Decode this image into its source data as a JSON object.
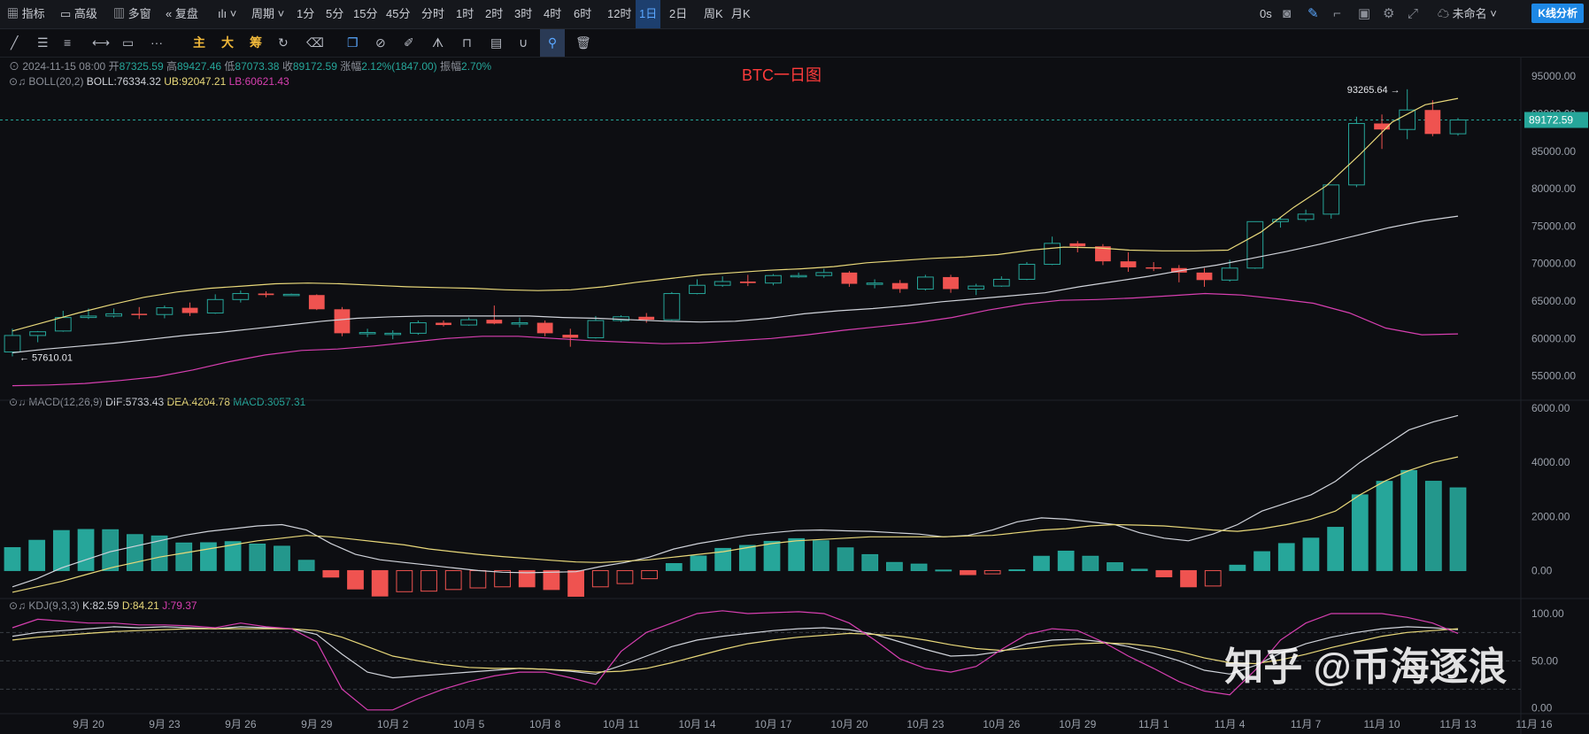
{
  "topbar": {
    "indicators": "指标",
    "advanced": "高级",
    "multi_window": "多窗",
    "replay": "复盘",
    "period": "周期",
    "intervals": [
      "1分",
      "5分",
      "15分",
      "45分",
      "分时",
      "1时",
      "2时",
      "3时",
      "4时",
      "6时",
      "12时",
      "1日",
      "2日",
      "周K",
      "月K"
    ],
    "active_interval": "1日",
    "latency": "0s",
    "layout_name": "未命名",
    "kline_button": "K线分析"
  },
  "toolbar2": {
    "labels": [
      "主",
      "大",
      "筹"
    ]
  },
  "info_rows": {
    "ohlc": {
      "date": "2024-11-15 08:00",
      "open_label": "开",
      "open": "87325.59",
      "high_label": "高",
      "high": "89427.46",
      "low_label": "低",
      "low": "87073.38",
      "close_label": "收",
      "close": "89172.59",
      "change_label": "涨幅",
      "change": "2.12%(1847.00)",
      "amp_label": "振幅",
      "amp": "2.70%"
    },
    "boll": {
      "name": "BOLL(20,2)",
      "boll": "BOLL:76334.32",
      "ub": "UB:92047.21",
      "lb": "LB:60621.43"
    },
    "macd": {
      "name": "MACD(12,26,9)",
      "dif": "DIF:5733.43",
      "dea": "DEA:4204.78",
      "macd": "MACD:3057.31"
    },
    "kdj": {
      "name": "KDJ(9,3,3)",
      "k": "K:82.59",
      "d": "D:84.21",
      "j": "J:79.37"
    }
  },
  "colors": {
    "up": "#26a69a",
    "down": "#ef5350",
    "boll_mid": "#d0d3da",
    "boll_ub": "#e8d87a",
    "boll_lb": "#d63fb0",
    "dif": "#d0d3da",
    "dea": "#e8d87a",
    "k": "#d0d3da",
    "d": "#e8d87a",
    "j": "#d63fb0",
    "title": "#ff3b3b"
  },
  "watermark": "知乎 @币海逐浪",
  "chart_data": {
    "title": "BTC一日图",
    "type": "candlestick",
    "x_ticks": [
      "9月 20",
      "9月 23",
      "9月 26",
      "9月 29",
      "10月 2",
      "10月 5",
      "10月 8",
      "10月 11",
      "10月 14",
      "10月 17",
      "10月 20",
      "10月 23",
      "10月 26",
      "10月 29",
      "11月 1",
      "11月 4",
      "11月 7",
      "11月 10",
      "11月 13",
      "11月 16"
    ],
    "price_ticks": [
      "95000.00",
      "90000.00",
      "85000.00",
      "80000.00",
      "75000.00",
      "70000.00",
      "65000.00",
      "60000.00",
      "55000.00"
    ],
    "price_ylim": [
      52000,
      97500
    ],
    "last_price": "89172.59",
    "high_annotation": "93265.64",
    "low_annotation": "57610.01",
    "candles": [
      {
        "o": 58200,
        "h": 61300,
        "l": 57610,
        "c": 60400
      },
      {
        "o": 60400,
        "h": 61000,
        "l": 59500,
        "c": 60900
      },
      {
        "o": 61000,
        "h": 63700,
        "l": 60900,
        "c": 62800
      },
      {
        "o": 62800,
        "h": 64000,
        "l": 62600,
        "c": 63000
      },
      {
        "o": 63000,
        "h": 64000,
        "l": 62800,
        "c": 63300
      },
      {
        "o": 63300,
        "h": 64200,
        "l": 62600,
        "c": 63200
      },
      {
        "o": 63200,
        "h": 64400,
        "l": 62700,
        "c": 64100
      },
      {
        "o": 64100,
        "h": 64800,
        "l": 63000,
        "c": 63400
      },
      {
        "o": 63400,
        "h": 65900,
        "l": 63300,
        "c": 65200
      },
      {
        "o": 65200,
        "h": 66400,
        "l": 64800,
        "c": 66000
      },
      {
        "o": 66000,
        "h": 66300,
        "l": 65500,
        "c": 65800
      },
      {
        "o": 65800,
        "h": 66000,
        "l": 65700,
        "c": 65900
      },
      {
        "o": 65800,
        "h": 65900,
        "l": 63800,
        "c": 63900
      },
      {
        "o": 63900,
        "h": 64200,
        "l": 60300,
        "c": 60700
      },
      {
        "o": 60700,
        "h": 61300,
        "l": 60200,
        "c": 60800
      },
      {
        "o": 60600,
        "h": 61100,
        "l": 59900,
        "c": 60700
      },
      {
        "o": 60700,
        "h": 62400,
        "l": 60500,
        "c": 62100
      },
      {
        "o": 62100,
        "h": 62400,
        "l": 61600,
        "c": 61800
      },
      {
        "o": 61800,
        "h": 62800,
        "l": 61700,
        "c": 62500
      },
      {
        "o": 62500,
        "h": 64400,
        "l": 61900,
        "c": 62000
      },
      {
        "o": 62000,
        "h": 62800,
        "l": 61500,
        "c": 62100
      },
      {
        "o": 62100,
        "h": 62400,
        "l": 60300,
        "c": 60700
      },
      {
        "o": 60500,
        "h": 61300,
        "l": 58900,
        "c": 60100
      },
      {
        "o": 60100,
        "h": 63000,
        "l": 60000,
        "c": 62400
      },
      {
        "o": 62400,
        "h": 63100,
        "l": 62200,
        "c": 62900
      },
      {
        "o": 62900,
        "h": 63400,
        "l": 62100,
        "c": 62500
      },
      {
        "o": 62500,
        "h": 66200,
        "l": 62400,
        "c": 66000
      },
      {
        "o": 66000,
        "h": 67900,
        "l": 65900,
        "c": 67100
      },
      {
        "o": 67100,
        "h": 68300,
        "l": 66900,
        "c": 67600
      },
      {
        "o": 67600,
        "h": 68500,
        "l": 67000,
        "c": 67400
      },
      {
        "o": 67400,
        "h": 68600,
        "l": 67100,
        "c": 68400
      },
      {
        "o": 68400,
        "h": 68800,
        "l": 68100,
        "c": 68400
      },
      {
        "o": 68400,
        "h": 69300,
        "l": 68100,
        "c": 68800
      },
      {
        "o": 68800,
        "h": 69000,
        "l": 66900,
        "c": 67300
      },
      {
        "o": 67300,
        "h": 67900,
        "l": 66700,
        "c": 67400
      },
      {
        "o": 67400,
        "h": 67800,
        "l": 66100,
        "c": 66600
      },
      {
        "o": 66600,
        "h": 68500,
        "l": 66400,
        "c": 68200
      },
      {
        "o": 68200,
        "h": 68500,
        "l": 66100,
        "c": 66600
      },
      {
        "o": 66600,
        "h": 67300,
        "l": 65800,
        "c": 67000
      },
      {
        "o": 67000,
        "h": 68300,
        "l": 66900,
        "c": 67900
      },
      {
        "o": 67900,
        "h": 70200,
        "l": 67800,
        "c": 69900
      },
      {
        "o": 69900,
        "h": 73600,
        "l": 69800,
        "c": 72700
      },
      {
        "o": 72700,
        "h": 73000,
        "l": 71500,
        "c": 72300
      },
      {
        "o": 72300,
        "h": 72600,
        "l": 69800,
        "c": 70300
      },
      {
        "o": 70300,
        "h": 71500,
        "l": 68900,
        "c": 69500
      },
      {
        "o": 69500,
        "h": 70200,
        "l": 69000,
        "c": 69400
      },
      {
        "o": 69400,
        "h": 69800,
        "l": 67500,
        "c": 68800
      },
      {
        "o": 68800,
        "h": 69400,
        "l": 66900,
        "c": 67800
      },
      {
        "o": 67800,
        "h": 70500,
        "l": 67600,
        "c": 69400
      },
      {
        "o": 69400,
        "h": 75600,
        "l": 69300,
        "c": 75600
      },
      {
        "o": 75600,
        "h": 76200,
        "l": 74800,
        "c": 75900
      },
      {
        "o": 75900,
        "h": 77200,
        "l": 75600,
        "c": 76600
      },
      {
        "o": 76600,
        "h": 80400,
        "l": 76000,
        "c": 80500
      },
      {
        "o": 80500,
        "h": 89600,
        "l": 80200,
        "c": 88700
      },
      {
        "o": 88700,
        "h": 89900,
        "l": 85300,
        "c": 87900
      },
      {
        "o": 87900,
        "h": 93265,
        "l": 86600,
        "c": 90500
      },
      {
        "o": 90500,
        "h": 91800,
        "l": 87000,
        "c": 87300
      },
      {
        "o": 87325,
        "h": 89427,
        "l": 87073,
        "c": 89172
      }
    ],
    "boll_mid": [
      58100,
      58600,
      59000,
      59400,
      59900,
      60400,
      60800,
      61300,
      61800,
      62300,
      62700,
      62900,
      63000,
      63000,
      63000,
      63000,
      62800,
      62700,
      62500,
      62300,
      62200,
      62300,
      62700,
      63300,
      63700,
      64000,
      64400,
      64900,
      65300,
      65700,
      66100,
      66900,
      67600,
      68300,
      69100,
      69800,
      70700,
      71600,
      72600,
      73700,
      74800,
      75700,
      76334
    ],
    "boll_ub": [
      61000,
      62200,
      63400,
      64500,
      65500,
      66200,
      66700,
      67000,
      67300,
      67400,
      67300,
      67100,
      66900,
      66800,
      66700,
      66500,
      66400,
      66500,
      66900,
      67500,
      68000,
      68500,
      68800,
      69100,
      69300,
      69600,
      70100,
      70400,
      70700,
      70900,
      71200,
      71800,
      72200,
      72100,
      71800,
      71700,
      71700,
      71800,
      74200,
      77500,
      80400,
      84500,
      88900,
      91200,
      92047
    ],
    "boll_lb": [
      53700,
      53800,
      54000,
      54400,
      54900,
      55800,
      56900,
      57800,
      58400,
      58600,
      59000,
      59500,
      60000,
      60300,
      60300,
      60000,
      59700,
      59500,
      59300,
      59400,
      59700,
      60000,
      60500,
      61100,
      61600,
      62100,
      62800,
      63800,
      64600,
      65100,
      65200,
      65400,
      65700,
      66000,
      65800,
      65300,
      64700,
      63400,
      61400,
      60500,
      60621
    ],
    "macd": {
      "ylim": [
        -1000,
        6200
      ],
      "ticks": [
        "6000.00",
        "4000.00",
        "2000.00",
        "0.00"
      ],
      "hist": [
        850,
        1120,
        1480,
        1520,
        1510,
        1330,
        1280,
        1020,
        1030,
        1070,
        980,
        900,
        380,
        -240,
        -680,
        -940,
        -780,
        -760,
        -700,
        -640,
        -600,
        -600,
        -700,
        -950,
        -600,
        -480,
        -300,
        260,
        540,
        820,
        930,
        1080,
        1180,
        1100,
        840,
        590,
        300,
        240,
        20,
        -150,
        -120,
        30,
        530,
        720,
        530,
        290,
        50,
        -230,
        -600,
        -570,
        200,
        700,
        1000,
        1200,
        1600,
        2800,
        3300,
        3700,
        3300,
        3057
      ],
      "dif": [
        -600,
        -300,
        100,
        400,
        700,
        900,
        1100,
        1300,
        1450,
        1550,
        1650,
        1700,
        1500,
        1000,
        600,
        400,
        300,
        200,
        100,
        0,
        -60,
        -80,
        -60,
        -40,
        150,
        300,
        500,
        800,
        1000,
        1150,
        1300,
        1400,
        1480,
        1500,
        1470,
        1450,
        1400,
        1350,
        1250,
        1300,
        1500,
        1800,
        1950,
        1900,
        1800,
        1700,
        1400,
        1200,
        1100,
        1350,
        1700,
        2200,
        2500,
        2800,
        3300,
        4000,
        4600,
        5200,
        5500,
        5733
      ],
      "dea": [
        -800,
        -600,
        -400,
        -150,
        100,
        300,
        500,
        650,
        800,
        950,
        1100,
        1200,
        1300,
        1250,
        1150,
        1050,
        950,
        800,
        700,
        600,
        520,
        450,
        380,
        320,
        300,
        350,
        400,
        500,
        600,
        700,
        850,
        1000,
        1100,
        1150,
        1200,
        1250,
        1250,
        1250,
        1250,
        1280,
        1300,
        1400,
        1500,
        1550,
        1650,
        1700,
        1680,
        1650,
        1580,
        1500,
        1450,
        1550,
        1700,
        1900,
        2200,
        2800,
        3300,
        3700,
        4000,
        4205
      ]
    },
    "kdj": {
      "ylim": [
        -5,
        115
      ],
      "ticks": [
        "100.00",
        "50.00",
        "0.00"
      ],
      "k": [
        76,
        80,
        82,
        84,
        86,
        85,
        86,
        85,
        84,
        86,
        85,
        84,
        78,
        57,
        38,
        32,
        34,
        36,
        38,
        40,
        42,
        41,
        39,
        36,
        45,
        55,
        65,
        72,
        76,
        79,
        82,
        84,
        85,
        83,
        78,
        70,
        62,
        55,
        56,
        60,
        68,
        72,
        73,
        70,
        65,
        58,
        50,
        40,
        36,
        45,
        58,
        68,
        75,
        80,
        84,
        86,
        85,
        83
      ],
      "d": [
        72,
        75,
        77,
        79,
        81,
        82,
        83,
        84,
        84,
        84,
        84,
        84,
        82,
        75,
        65,
        55,
        50,
        46,
        43,
        42,
        42,
        41,
        40,
        38,
        39,
        42,
        48,
        55,
        62,
        68,
        72,
        75,
        77,
        79,
        78,
        76,
        72,
        67,
        63,
        61,
        63,
        66,
        68,
        69,
        68,
        65,
        60,
        53,
        48,
        47,
        51,
        57,
        64,
        70,
        76,
        80,
        82,
        84
      ],
      "j": [
        85,
        94,
        92,
        90,
        90,
        88,
        88,
        87,
        85,
        90,
        86,
        84,
        70,
        20,
        -2,
        -2,
        10,
        20,
        28,
        34,
        38,
        38,
        32,
        25,
        60,
        80,
        90,
        100,
        103,
        100,
        101,
        102,
        100,
        90,
        72,
        52,
        42,
        38,
        44,
        62,
        78,
        84,
        82,
        70,
        55,
        42,
        28,
        18,
        14,
        40,
        72,
        90,
        100,
        100,
        100,
        96,
        90,
        79
      ]
    }
  }
}
